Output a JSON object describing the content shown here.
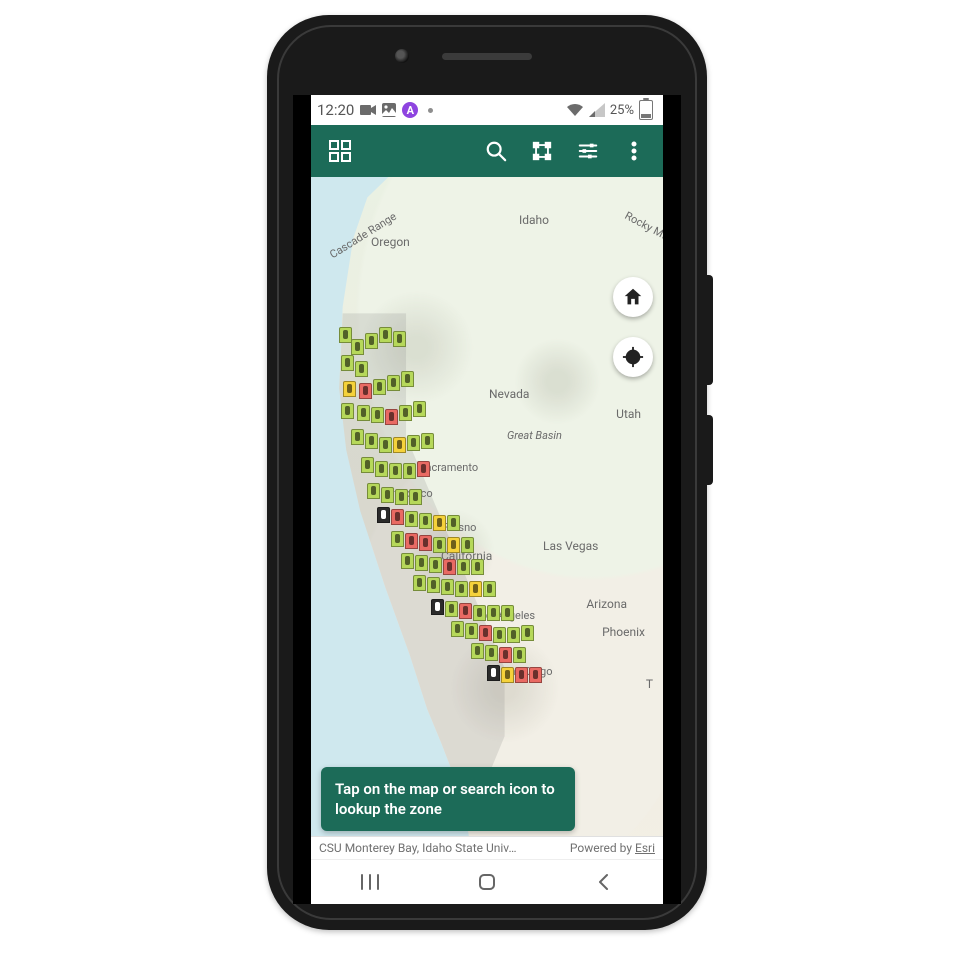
{
  "theme": {
    "accent": "#1c6b58",
    "appbar": "#1c6b58",
    "tip_bg": "#1c6b58"
  },
  "status_bar": {
    "time": "12:20",
    "left_icons": [
      "record",
      "picture",
      "app-badge",
      "dot"
    ],
    "app_badge_letter": "A",
    "wifi_icon": "wifi",
    "signal_icon": "signal",
    "battery_percent": "25%"
  },
  "appbar": {
    "left_button": "apps",
    "right_buttons": [
      "search",
      "select-area",
      "tune",
      "overflow"
    ]
  },
  "map": {
    "labels": {
      "oregon": "Oregon",
      "idaho": "Idaho",
      "cascade": "Cascade Range",
      "rocky": "Rocky Mt",
      "nevada": "Nevada",
      "utah": "Utah",
      "great_basin": "Great Basin",
      "california": "California",
      "las_vegas": "Las Vegas",
      "arizona": "Arizona",
      "phoenix": "Phoenix",
      "tucson": "T",
      "sacramento": "Sacramento",
      "san_francisco": "Francisco",
      "fresno": "Fresno",
      "los_angeles": "Los Angeles",
      "san_diego": "San Diego"
    },
    "fab_home": "home",
    "fab_locate": "locate",
    "tip": "Tap on the map or search icon to lookup the zone",
    "attribution_left": "CSU Monterey Bay, Idaho State Univ…",
    "attribution_right_prefix": "Powered by",
    "attribution_brand": "Esri"
  },
  "sysnav": {
    "recents": "recents",
    "home": "home",
    "back": "back"
  }
}
